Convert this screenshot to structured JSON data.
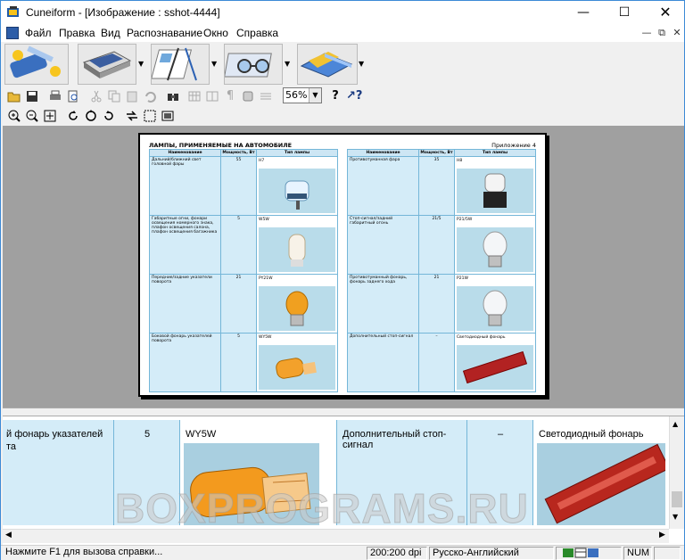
{
  "window": {
    "title": "Cuneiform - [Изображение : sshot-4444]"
  },
  "menu": [
    "Файл",
    "Правка",
    "Вид",
    "Распознавание",
    "Окно",
    "Справка"
  ],
  "toolbar": {
    "zoom_value": "56%"
  },
  "document": {
    "title": "ЛАМПЫ, ПРИМЕНЯЕМЫЕ НА АВТОМОБИЛЕ",
    "note": "Приложение 4",
    "headers": [
      "Наименование",
      "Мощность, Вт",
      "Тип лампы"
    ],
    "left_rows": [
      {
        "name": "Дальний/ближний свет головной фары",
        "power": "55",
        "type": "H7"
      },
      {
        "name": "Габаритные огни, фонари освещения номерного знака, плафон освещения салона, плафон освещения багажника",
        "power": "5",
        "type": "W5W"
      },
      {
        "name": "Передние/задние указатели поворота",
        "power": "21",
        "type": "PY21W"
      },
      {
        "name": "Боковой фонарь указателей поворота",
        "power": "5",
        "type": "WY5W"
      }
    ],
    "right_rows": [
      {
        "name": "Противотуманная фара",
        "power": "35",
        "type": "H8"
      },
      {
        "name": "Стоп-сигнал/задний габаритный огонь",
        "power": "21/5",
        "type": "P21/5W"
      },
      {
        "name": "Противотуманный фонарь, фонарь заднего хода",
        "power": "21",
        "type": "P21W"
      },
      {
        "name": "Дополнительный стоп-сигнал",
        "power": "–",
        "type": "Светодиодный фонарь"
      }
    ]
  },
  "zoom_view": {
    "col1": "й фонарь указателей",
    "col1_line2": "та",
    "col2": "5",
    "col3": "WY5W",
    "col4": "Дополнительный стоп-сигнал",
    "col5": "–",
    "col6": "Светодиодный фонарь",
    "watermark": "BOXPROGRAMS.RU"
  },
  "status": {
    "help": "Нажмите F1 для вызова справки...",
    "dpi": "200:200 dpi",
    "lang": "Русско-Английский",
    "num": "NUM"
  }
}
